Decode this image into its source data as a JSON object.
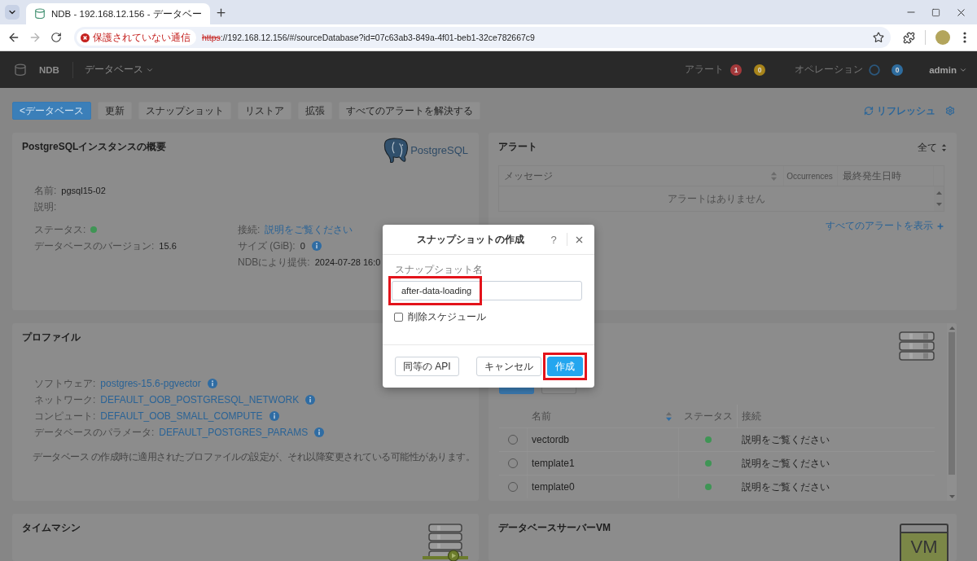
{
  "browser": {
    "tab_title": "NDB - 192.168.12.156 - データベー",
    "back_disabled": false,
    "forward_disabled": true,
    "security_label": "保護されていない通信",
    "url": {
      "scheme": "https",
      "rest": "://192.168.12.156/#/sourceDatabase?id=07c63ab3-849a-4f01-beb1-32ce782667c9",
      "insecure": true
    }
  },
  "header": {
    "product": "NDB",
    "menu": "データベース",
    "alerts_label": "アラート",
    "alert_badges": [
      {
        "count": "1",
        "color": "#a3393b"
      },
      {
        "count": "0",
        "color": "#a8841a"
      }
    ],
    "operations_label": "オペレーション",
    "operation_badges": [
      {
        "count": "0",
        "color": "#2e6c9e"
      }
    ],
    "user": "admin"
  },
  "toolbar": {
    "buttons": [
      {
        "label": "<データベース",
        "kind": "primary"
      },
      {
        "label": "更新",
        "kind": "default"
      },
      {
        "label": "スナップショット",
        "kind": "default"
      },
      {
        "label": "リストア",
        "kind": "default"
      },
      {
        "label": "拡張",
        "kind": "default"
      },
      {
        "label": "すべてのアラートを解決する",
        "kind": "default"
      }
    ],
    "refresh": "リフレッシュ"
  },
  "overview": {
    "title": "PostgreSQLインスタンスの概要",
    "logo": "PostgreSQL",
    "identity": [
      {
        "kind": "text",
        "label": "名前:",
        "value": "pgsql15-02"
      },
      {
        "kind": "text",
        "label": "説明:"
      }
    ],
    "details_left": [
      {
        "kind": "status",
        "label": "ステータス:",
        "color": "#3f9555"
      },
      {
        "kind": "text",
        "label": "データベースのバージョン:",
        "value": "15.6"
      }
    ],
    "details_right": [
      {
        "kind": "link",
        "label": "接続:",
        "value": "説明をご覧ください"
      },
      {
        "kind": "info",
        "label": "サイズ (GiB):",
        "value": "0"
      },
      {
        "kind": "text",
        "label": "NDBにより提供:",
        "value": "2024-07-28 16:0"
      }
    ]
  },
  "alerts": {
    "title": "アラート",
    "filter": "全て",
    "columns": [
      {
        "label": "メッセージ",
        "sortable": true,
        "sorted": false
      },
      {
        "label": "Occurrences"
      },
      {
        "label": "最終発生日時"
      }
    ],
    "empty_text": "アラートはありません",
    "view_all": "すべてのアラートを表示"
  },
  "profile": {
    "title": "プロファイル",
    "fields": [
      {
        "label": "ソフトウェア:",
        "value": "postgres-15.6-pgvector"
      },
      {
        "label": "ネットワーク:",
        "value": "DEFAULT_OOB_POSTGRESQL_NETWORK"
      },
      {
        "label": "コンピュート:",
        "value": "DEFAULT_OOB_SMALL_COMPUTE"
      },
      {
        "label": "データベースのパラメータ:",
        "value": "DEFAULT_POSTGRES_PARAMS"
      }
    ],
    "note": "データベース の作成時に適用されたプロファイルの設定が、それ以降変更されている可能性があります。"
  },
  "databases": {
    "view_buttons": [
      {
        "selected": true
      },
      {
        "selected": false
      }
    ],
    "columns": [
      {
        "label": "名前",
        "sortable": true,
        "sorted": true
      },
      {
        "label": "ステータス"
      },
      {
        "label": "接続"
      }
    ],
    "rows": [
      {
        "name": "vectordb",
        "selected": false,
        "color": "#3f9555",
        "connection": "説明をご覧ください"
      },
      {
        "name": "template1",
        "selected": false,
        "color": "#3f9555",
        "connection": "説明をご覧ください"
      },
      {
        "name": "template0",
        "selected": false,
        "color": "#3f9555",
        "connection": "説明をご覧ください"
      }
    ]
  },
  "time_machine": {
    "title": "タイムマシン"
  },
  "db_server_vm": {
    "title": "データベースサーバーVM",
    "icon_label": "VM"
  },
  "modal": {
    "title": "スナップショットの作成",
    "help": "?",
    "field": {
      "label": "スナップショット名",
      "value": "after-data-loading",
      "highlighted": true
    },
    "checkbox": {
      "label": "削除スケジュール",
      "checked": false
    },
    "buttons": [
      {
        "label": "同等の API",
        "kind": "default",
        "highlighted": false
      },
      {
        "label": "キャンセル",
        "kind": "default",
        "highlighted": false
      },
      {
        "label": "作成",
        "kind": "primary",
        "highlighted": true
      }
    ]
  }
}
